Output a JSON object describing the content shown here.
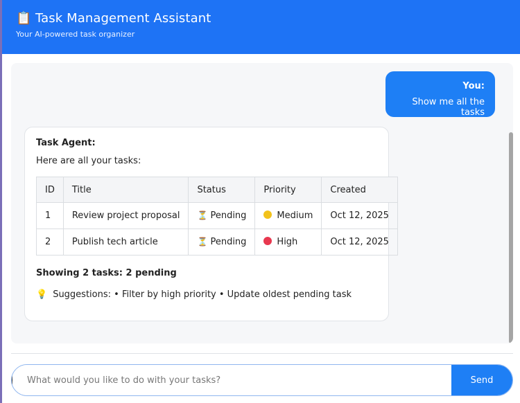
{
  "header": {
    "icon": "clipboard-icon",
    "title": "Task Management Assistant",
    "subtitle": "Your AI-powered task organizer"
  },
  "colors": {
    "accent": "#1e73f5",
    "pending": "#c89a3b",
    "medium": "#f2c21b",
    "high": "#e8384f"
  },
  "messages": {
    "user": {
      "who": "You:",
      "text": "Show me all the tasks"
    },
    "agent": {
      "who": "Task Agent:",
      "intro": "Here are all your tasks:",
      "table": {
        "headers": [
          "ID",
          "Title",
          "Status",
          "Priority",
          "Created"
        ],
        "rows": [
          {
            "id": "1",
            "title": "Review project proposal",
            "status": "Pending",
            "priority": "Medium",
            "created": "Oct 12, 2025"
          },
          {
            "id": "2",
            "title": "Publish tech article",
            "status": "Pending",
            "priority": "High",
            "created": "Oct 12, 2025"
          }
        ]
      },
      "summary": "Showing 2 tasks: 2 pending",
      "suggestions": "Suggestions: • Filter by high priority • Update oldest pending task"
    }
  },
  "composer": {
    "placeholder": "What would you like to do with your tasks?",
    "send_label": "Send"
  }
}
